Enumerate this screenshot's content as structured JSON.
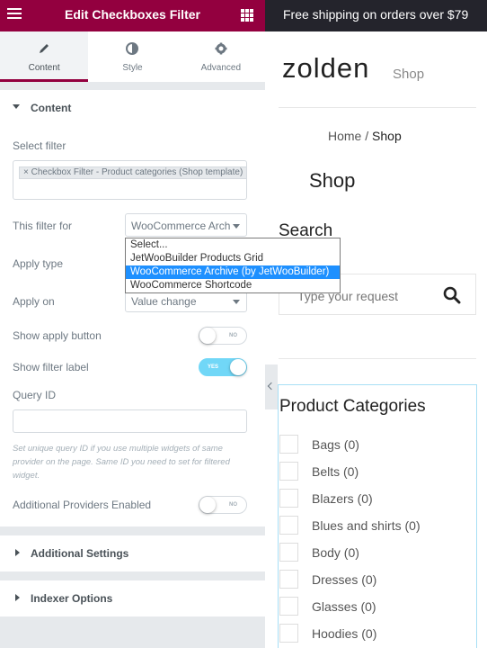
{
  "panel": {
    "title": "Edit Checkboxes Filter",
    "tabs": [
      {
        "label": "Content",
        "icon": "pencil-icon"
      },
      {
        "label": "Style",
        "icon": "contrast-icon"
      },
      {
        "label": "Advanced",
        "icon": "gear-icon"
      }
    ],
    "content_section": "Content",
    "select_filter_label": "Select filter",
    "select_filter_chip": "× Checkbox Filter - Product categories (Shop template)",
    "filter_for_label": "This filter for",
    "filter_for_value": "WooCommerce Archive (by JetWooBuilder)",
    "dropdown_options": [
      "Select...",
      "JetWooBuilder Products Grid",
      "WooCommerce Archive (by JetWooBuilder)",
      "WooCommerce Shortcode"
    ],
    "apply_type_label": "Apply type",
    "apply_on_label": "Apply on",
    "apply_on_value": "Value change",
    "show_apply_label": "Show apply button",
    "show_apply_toggle": "NO",
    "show_filter_label_label": "Show filter label",
    "show_filter_label_toggle": "YES",
    "query_id_label": "Query ID",
    "query_id_desc": "Set unique query ID if you use multiple widgets of same provider on the page. Same ID you need to set for filtered widget.",
    "providers_label": "Additional Providers Enabled",
    "providers_toggle": "NO",
    "additional_settings": "Additional Settings",
    "indexer_options": "Indexer Options"
  },
  "site": {
    "topbar": "Free shipping on orders over $79",
    "brand": "zolden",
    "brand_nav": "Shop",
    "breadcrumb_home": "Home",
    "breadcrumb_sep": " / ",
    "breadcrumb_current": "Shop",
    "page_title": "Shop",
    "search_title": "Search",
    "search_placeholder": "Type your request",
    "categories_title": "Product Categories",
    "categories": [
      "Bags (0)",
      "Belts (0)",
      "Blazers (0)",
      "Blues and shirts (0)",
      "Body (0)",
      "Dresses (0)",
      "Glasses (0)",
      "Hoodies (0)"
    ]
  },
  "colors": {
    "accent": "#93003f",
    "toggle_on": "#71d7f7",
    "dropdown_selected": "#1e90ff",
    "topbar": "#24242c"
  }
}
